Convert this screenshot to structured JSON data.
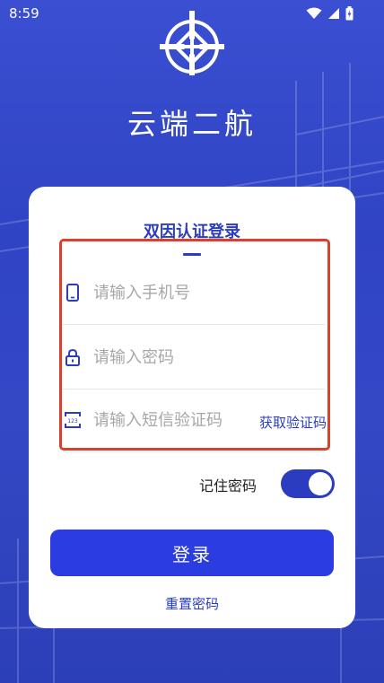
{
  "status_bar": {
    "time": "8:59"
  },
  "app": {
    "title": "云端二航"
  },
  "login_card": {
    "title": "双因认证登录",
    "phone": {
      "value": "",
      "placeholder": "请输入手机号"
    },
    "password": {
      "value": "",
      "placeholder": "请输入密码"
    },
    "sms_code": {
      "value": "",
      "placeholder": "请输入短信验证码",
      "code_icon_text": "123"
    },
    "get_code_label": "获取验证码",
    "remember_label": "记住密码",
    "remember_enabled": true,
    "login_label": "登录",
    "reset_label": "重置密码"
  },
  "colors": {
    "primary": "#2b3cc1",
    "button": "#2b3ce0",
    "highlight": "#d9412e",
    "background": "#3346c9"
  },
  "icons": [
    "wifi-icon",
    "signal-icon",
    "battery-icon",
    "logo-icon",
    "phone-icon",
    "lock-icon",
    "sms-code-icon"
  ]
}
